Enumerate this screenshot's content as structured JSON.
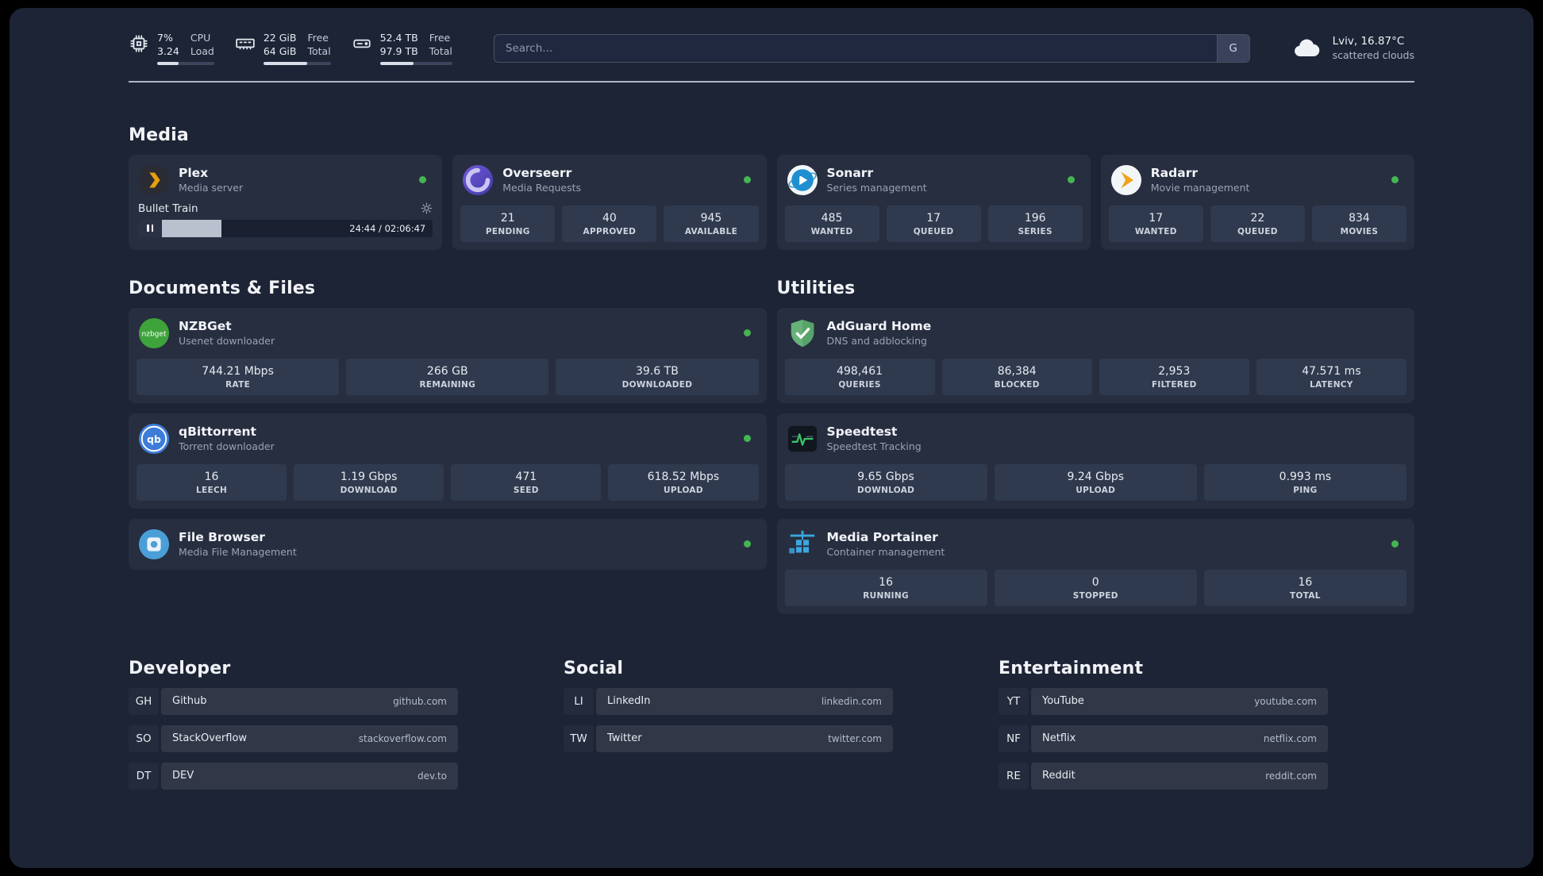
{
  "topbar": {
    "cpu": {
      "percent": "7%",
      "load": "3.24",
      "label_percent": "CPU",
      "label_load": "Load"
    },
    "ram": {
      "free": "22 GiB",
      "total": "64 GiB",
      "label_free": "Free",
      "label_total": "Total"
    },
    "disk": {
      "free": "52.4 TB",
      "total": "97.9 TB",
      "label_free": "Free",
      "label_total": "Total"
    },
    "search": {
      "placeholder": "Search...",
      "provider": "G"
    },
    "weather": {
      "location": "Lviv, 16.87°C",
      "condition": "scattered clouds"
    }
  },
  "media": {
    "title": "Media",
    "plex": {
      "name": "Plex",
      "desc": "Media server",
      "now_playing": "Bullet Train",
      "time": "24:44 / 02:06:47"
    },
    "overseerr": {
      "name": "Overseerr",
      "desc": "Media Requests",
      "stats": [
        {
          "value": "21",
          "label": "PENDING"
        },
        {
          "value": "40",
          "label": "APPROVED"
        },
        {
          "value": "945",
          "label": "AVAILABLE"
        }
      ]
    },
    "sonarr": {
      "name": "Sonarr",
      "desc": "Series management",
      "stats": [
        {
          "value": "485",
          "label": "WANTED"
        },
        {
          "value": "17",
          "label": "QUEUED"
        },
        {
          "value": "196",
          "label": "SERIES"
        }
      ]
    },
    "radarr": {
      "name": "Radarr",
      "desc": "Movie management",
      "stats": [
        {
          "value": "17",
          "label": "WANTED"
        },
        {
          "value": "22",
          "label": "QUEUED"
        },
        {
          "value": "834",
          "label": "MOVIES"
        }
      ]
    }
  },
  "files": {
    "title": "Documents & Files",
    "nzbget": {
      "name": "NZBGet",
      "desc": "Usenet downloader",
      "stats": [
        {
          "value": "744.21 Mbps",
          "label": "RATE"
        },
        {
          "value": "266 GB",
          "label": "REMAINING"
        },
        {
          "value": "39.6 TB",
          "label": "DOWNLOADED"
        }
      ]
    },
    "qbittorrent": {
      "name": "qBittorrent",
      "desc": "Torrent downloader",
      "stats": [
        {
          "value": "16",
          "label": "LEECH"
        },
        {
          "value": "1.19 Gbps",
          "label": "DOWNLOAD"
        },
        {
          "value": "471",
          "label": "SEED"
        },
        {
          "value": "618.52 Mbps",
          "label": "UPLOAD"
        }
      ]
    },
    "filebrowser": {
      "name": "File Browser",
      "desc": "Media File Management"
    }
  },
  "utilities": {
    "title": "Utilities",
    "adguard": {
      "name": "AdGuard Home",
      "desc": "DNS and adblocking",
      "stats": [
        {
          "value": "498,461",
          "label": "QUERIES"
        },
        {
          "value": "86,384",
          "label": "BLOCKED"
        },
        {
          "value": "2,953",
          "label": "FILTERED"
        },
        {
          "value": "47.571 ms",
          "label": "LATENCY"
        }
      ]
    },
    "speedtest": {
      "name": "Speedtest",
      "desc": "Speedtest Tracking",
      "stats": [
        {
          "value": "9.65 Gbps",
          "label": "DOWNLOAD"
        },
        {
          "value": "9.24 Gbps",
          "label": "UPLOAD"
        },
        {
          "value": "0.993 ms",
          "label": "PING"
        }
      ]
    },
    "portainer": {
      "name": "Media Portainer",
      "desc": "Container management",
      "stats": [
        {
          "value": "16",
          "label": "RUNNING"
        },
        {
          "value": "0",
          "label": "STOPPED"
        },
        {
          "value": "16",
          "label": "TOTAL"
        }
      ]
    }
  },
  "bookmarks": {
    "developer": {
      "title": "Developer",
      "items": [
        {
          "abbr": "GH",
          "name": "Github",
          "url": "github.com"
        },
        {
          "abbr": "SO",
          "name": "StackOverflow",
          "url": "stackoverflow.com"
        },
        {
          "abbr": "DT",
          "name": "DEV",
          "url": "dev.to"
        }
      ]
    },
    "social": {
      "title": "Social",
      "items": [
        {
          "abbr": "LI",
          "name": "LinkedIn",
          "url": "linkedin.com"
        },
        {
          "abbr": "TW",
          "name": "Twitter",
          "url": "twitter.com"
        }
      ]
    },
    "entertainment": {
      "title": "Entertainment",
      "items": [
        {
          "abbr": "YT",
          "name": "YouTube",
          "url": "youtube.com"
        },
        {
          "abbr": "NF",
          "name": "Netflix",
          "url": "netflix.com"
        },
        {
          "abbr": "RE",
          "name": "Reddit",
          "url": "reddit.com"
        }
      ]
    }
  }
}
